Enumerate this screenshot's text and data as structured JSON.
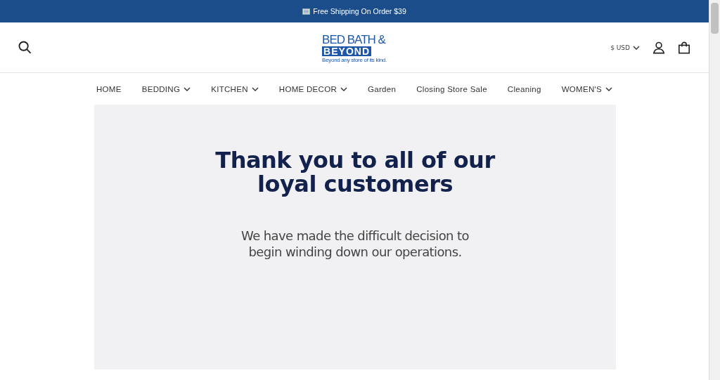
{
  "announcement": {
    "text": "Free Shipping On Order $39"
  },
  "logo": {
    "line_1": "BED BATH &",
    "line_2": "BEYOND",
    "tagline": "Beyond any store of its kind."
  },
  "currency": {
    "label": "$ USD"
  },
  "nav": [
    {
      "label": "HOME",
      "has_menu": false
    },
    {
      "label": "BEDDING",
      "has_menu": true
    },
    {
      "label": "KITCHEN",
      "has_menu": true
    },
    {
      "label": "HOME DECOR",
      "has_menu": true
    },
    {
      "label": "Garden",
      "has_menu": false
    },
    {
      "label": "Closing Store Sale",
      "has_menu": false
    },
    {
      "label": "Cleaning",
      "has_menu": false
    },
    {
      "label": "WOMEN'S",
      "has_menu": true
    }
  ],
  "hero": {
    "heading": "Thank you to all of our loyal customers",
    "body": "We have made the difficult decision to begin winding down our operations."
  }
}
